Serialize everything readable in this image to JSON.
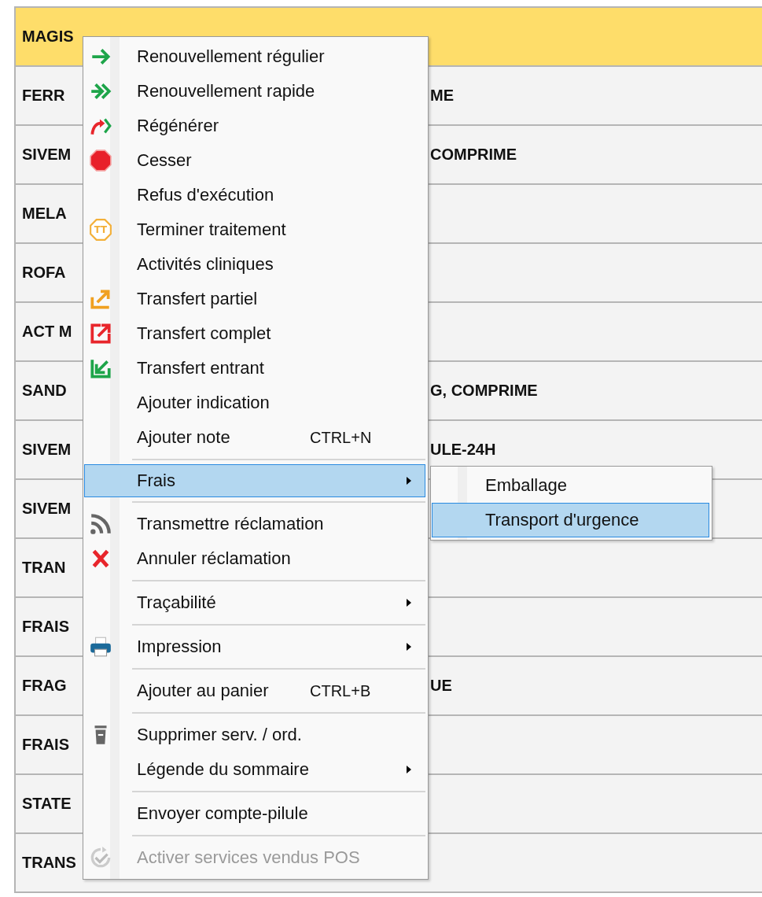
{
  "table": {
    "rows": [
      {
        "cell_1": "MAGIS",
        "selected": true
      },
      {
        "cell_1": "FERR",
        "cell_2": "ME",
        "selected": false
      },
      {
        "cell_1": "SIVEM",
        "cell_2": "COMPRIME",
        "selected": false
      },
      {
        "cell_1": "MELA",
        "selected": false
      },
      {
        "cell_1": "ROFA",
        "selected": false
      },
      {
        "cell_1": "ACT M",
        "selected": false
      },
      {
        "cell_1": "SAND",
        "cell_2": "G, COMPRIME",
        "selected": false
      },
      {
        "cell_1": "SIVEM",
        "cell_2": "ULE-24H",
        "selected": false
      },
      {
        "cell_1": "SIVEM",
        "selected": false
      },
      {
        "cell_1": "TRAN",
        "selected": false
      },
      {
        "cell_1": "FRAIS",
        "selected": false
      },
      {
        "cell_1": "FRAG",
        "cell_2": "UE",
        "selected": false
      },
      {
        "cell_1": "FRAIS",
        "selected": false
      },
      {
        "cell_1": "STATE",
        "selected": false
      },
      {
        "cell_1": "TRANS",
        "selected": false
      }
    ]
  },
  "context_menu": {
    "items": [
      {
        "kind": "item",
        "label": "Renouvellement régulier",
        "selected": false,
        "disabled": false
      },
      {
        "kind": "item",
        "label": "Renouvellement rapide",
        "selected": false,
        "disabled": false
      },
      {
        "kind": "item",
        "label": "Régénérer",
        "selected": false,
        "disabled": false
      },
      {
        "kind": "item",
        "label": "Cesser",
        "selected": false,
        "disabled": false
      },
      {
        "kind": "item",
        "label": "Refus d'exécution",
        "selected": false,
        "disabled": false
      },
      {
        "kind": "item",
        "label": "Terminer traitement",
        "icon_text": "TT",
        "selected": false,
        "disabled": false
      },
      {
        "kind": "item",
        "label": "Activités cliniques",
        "selected": false,
        "disabled": false
      },
      {
        "kind": "item",
        "label": "Transfert partiel",
        "selected": false,
        "disabled": false
      },
      {
        "kind": "item",
        "label": "Transfert complet",
        "selected": false,
        "disabled": false
      },
      {
        "kind": "item",
        "label": "Transfert entrant",
        "selected": false,
        "disabled": false
      },
      {
        "kind": "item",
        "label": "Ajouter indication",
        "selected": false,
        "disabled": false
      },
      {
        "kind": "item",
        "label": "Ajouter note",
        "shortcut": "CTRL+N",
        "selected": false,
        "disabled": false
      },
      {
        "kind": "separator"
      },
      {
        "kind": "item",
        "label": "Frais",
        "submenu": true,
        "selected": true,
        "disabled": false
      },
      {
        "kind": "separator"
      },
      {
        "kind": "item",
        "label": "Transmettre réclamation",
        "selected": false,
        "disabled": false
      },
      {
        "kind": "item",
        "label": "Annuler réclamation",
        "selected": false,
        "disabled": false
      },
      {
        "kind": "separator"
      },
      {
        "kind": "item",
        "label": "Traçabilité",
        "submenu": true,
        "selected": false,
        "disabled": false
      },
      {
        "kind": "separator"
      },
      {
        "kind": "item",
        "label": "Impression",
        "submenu": true,
        "selected": false,
        "disabled": false
      },
      {
        "kind": "separator"
      },
      {
        "kind": "item",
        "label": "Ajouter au panier",
        "shortcut": "CTRL+B",
        "selected": false,
        "disabled": false
      },
      {
        "kind": "separator"
      },
      {
        "kind": "item",
        "label": "Supprimer serv. / ord.",
        "selected": false,
        "disabled": false
      },
      {
        "kind": "item",
        "label": "Légende du sommaire",
        "submenu": true,
        "selected": false,
        "disabled": false
      },
      {
        "kind": "separator"
      },
      {
        "kind": "item",
        "label": "Envoyer compte-pilule",
        "selected": false,
        "disabled": false
      },
      {
        "kind": "separator"
      },
      {
        "kind": "item",
        "label": "Activer services vendus POS",
        "selected": false,
        "disabled": true
      }
    ]
  },
  "submenu": {
    "items": [
      {
        "label": "Emballage",
        "selected": false
      },
      {
        "label": "Transport d'urgence",
        "selected": true
      }
    ]
  }
}
